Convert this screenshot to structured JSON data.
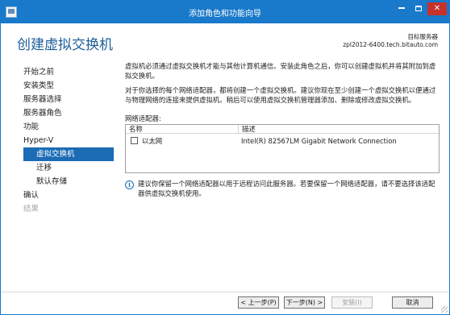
{
  "window": {
    "title": "添加角色和功能向导",
    "controls": {
      "minimize": "minimize",
      "maximize": "maximize",
      "close": "✕"
    }
  },
  "page": {
    "heading": "创建虚拟交换机",
    "destination_label": "目标服务器",
    "destination_server": "zpl2012-6400.tech.bitauto.com"
  },
  "nav": {
    "items": [
      {
        "label": "开始之前",
        "state": "normal",
        "indent": false
      },
      {
        "label": "安装类型",
        "state": "normal",
        "indent": false
      },
      {
        "label": "服务器选择",
        "state": "normal",
        "indent": false
      },
      {
        "label": "服务器角色",
        "state": "normal",
        "indent": false
      },
      {
        "label": "功能",
        "state": "normal",
        "indent": false
      },
      {
        "label": "Hyper-V",
        "state": "normal",
        "indent": false
      },
      {
        "label": "虚拟交换机",
        "state": "selected",
        "indent": true
      },
      {
        "label": "迁移",
        "state": "normal",
        "indent": true
      },
      {
        "label": "默认存储",
        "state": "normal",
        "indent": true
      },
      {
        "label": "确认",
        "state": "normal",
        "indent": false
      },
      {
        "label": "结果",
        "state": "disabled",
        "indent": false
      }
    ]
  },
  "content": {
    "paragraph1": "虚拟机必须通过虚拟交换机才能与其他计算机通信。安装此角色之后，你可以创建虚拟机并将其附加到虚拟交换机。",
    "paragraph2": "对于你选择的每个网络适配器，都将创建一个虚拟交换机。建议你现在至少创建一个虚拟交换机以便通过与物理网络的连接来提供虚拟机。稍后可以使用虚拟交换机管理器添加、删除或修改虚拟交换机。",
    "adapters_label": "网络适配器:",
    "table": {
      "columns": [
        "名称",
        "描述"
      ],
      "rows": [
        {
          "name": "以太网",
          "description": "Intel(R) 82567LM Gigabit Network Connection",
          "checked": false
        }
      ]
    },
    "note": "建议你保留一个网络适配器以用于远程访问此服务器。若要保留一个网络适配器，请不要选择该适配器供虚拟交换机使用。"
  },
  "buttons": {
    "previous": "< 上一步(P)",
    "next": "下一步(N) >",
    "install": "安装(I)",
    "cancel": "取消"
  },
  "colors": {
    "accent": "#1979ca",
    "heading": "#1c5d99",
    "selected": "#1b6bb5"
  }
}
